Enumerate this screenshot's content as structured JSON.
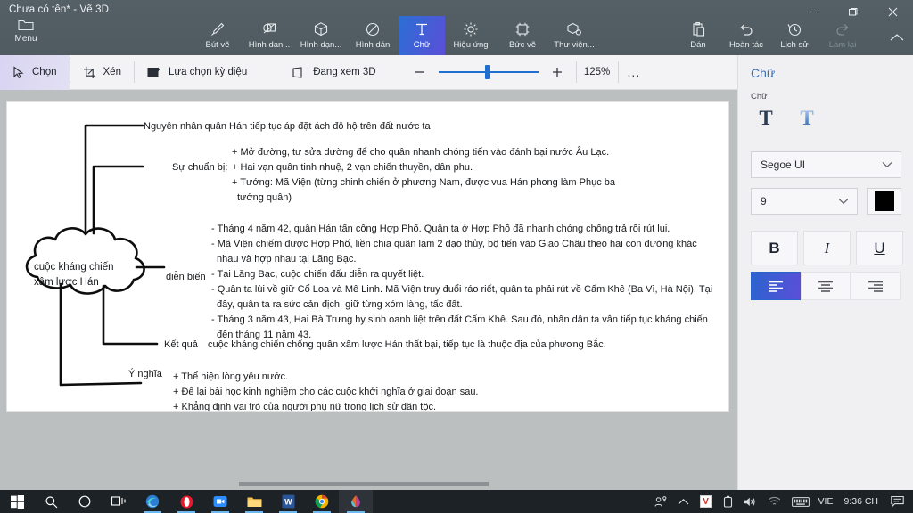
{
  "window": {
    "title": "Chưa có tên* - Vẽ 3D",
    "minimize_label": "Thu nhỏ",
    "maximize_label": "Phóng to",
    "close_label": "Đóng"
  },
  "ribbon": {
    "menu_label": "Menu",
    "tools": [
      {
        "id": "but-ve",
        "label": "Bút vẽ",
        "icon": "brush-icon",
        "active": false
      },
      {
        "id": "hinh-dang-2d",
        "label": "Hình dạn...",
        "icon": "shapes-2d-icon",
        "active": false
      },
      {
        "id": "hinh-dang-3d",
        "label": "Hình dạn...",
        "icon": "shapes-3d-icon",
        "active": false
      },
      {
        "id": "hinh-dan",
        "label": "Hình dán",
        "icon": "sticker-icon",
        "active": false
      },
      {
        "id": "chu",
        "label": "Chữ",
        "icon": "text-icon",
        "active": true
      },
      {
        "id": "hieu-ung",
        "label": "Hiệu ứng",
        "icon": "effects-icon",
        "active": false
      },
      {
        "id": "buc-ve",
        "label": "Bức vẽ",
        "icon": "canvas-icon",
        "active": false
      },
      {
        "id": "thu-vien",
        "label": "Thư viện...",
        "icon": "library-icon",
        "active": false
      }
    ],
    "right_tools": [
      {
        "id": "dan",
        "label": "Dán",
        "icon": "paste-icon",
        "disabled": false
      },
      {
        "id": "hoan-tac",
        "label": "Hoàn tác",
        "icon": "undo-icon",
        "disabled": false
      },
      {
        "id": "lich-su",
        "label": "Lịch sử",
        "icon": "history-icon",
        "disabled": false
      },
      {
        "id": "lam-lai",
        "label": "Làm lại",
        "icon": "redo-icon",
        "disabled": true
      }
    ],
    "collapse_label": "Thu gọn dải băng"
  },
  "subbar": {
    "items": [
      {
        "id": "chon",
        "label": "Chọn",
        "icon": "cursor-select-icon",
        "selected": true
      },
      {
        "id": "xen",
        "label": "Xén",
        "icon": "crop-icon",
        "selected": false
      },
      {
        "id": "lua-chon-ky-dieu",
        "label": "Lựa chọn kỳ diệu",
        "icon": "magic-select-icon",
        "selected": false
      }
    ],
    "view3d_label": "Đang xem 3D",
    "view3d_icon": "view-3d-icon",
    "zoom_out_label": "Thu nhỏ",
    "zoom_in_label": "Phóng to",
    "zoom_value": "125%",
    "zoom_slider_percent": 47,
    "more_label": "..."
  },
  "panel": {
    "title": "Chữ",
    "section_label": "Chữ",
    "text_styles": [
      {
        "id": "text-2d",
        "glyph": "T",
        "label": "Chữ 2D",
        "selected": false
      },
      {
        "id": "text-3d",
        "glyph": "T",
        "label": "Chữ 3D",
        "selected": false
      }
    ],
    "font_family": "Segoe UI",
    "font_size": "9",
    "color_hex": "#000000",
    "bold_label": "B",
    "italic_label": "I",
    "underline_label": "U",
    "align": [
      {
        "id": "align-left",
        "label": "Căn trái",
        "active": true
      },
      {
        "id": "align-center",
        "label": "Căn giữa",
        "active": false
      },
      {
        "id": "align-right",
        "label": "Căn phải",
        "active": false
      }
    ]
  },
  "canvas": {
    "center_node": "cuộc kháng chiến\nxâm lược Hán",
    "center_node_line1": "cuộc kháng chiến",
    "center_node_line2": "xâm lược Hán",
    "branches": [
      {
        "id": "nguyen-nhan",
        "label": "Nguyên nhân",
        "body": "quân Hán tiếp tục áp đặt ách đô hộ trên đất nước ta"
      },
      {
        "id": "su-chuan-bi",
        "label": "Sự chuẩn bị:",
        "lines": [
          "+ Mở đường, tư sửa dường để cho quân nhanh chóng tiến vào đánh bại nước Âu Lạc.",
          "+ Hai vạn quân tinh nhuệ, 2 vạn chiến thuyền, dân phu.",
          "+ Tướng: Mã Viện (từng chinh chiến ở phương Nam, được vua Hán phong làm Phục ba",
          "tướng quân)"
        ]
      },
      {
        "id": "dien-bien",
        "label": "diễn biến",
        "lines": [
          "- Tháng 4 năm 42, quân Hán tấn công Hợp Phố. Quân ta ở Hợp Phố đã nhanh chóng chống trả rồi rút lui.",
          "- Mã Viện chiếm được Hợp Phố, liền chia quân làm 2 đạo thủy, bộ tiến vào Giao Châu theo hai con đường khác",
          "nhau và hợp nhau tại Lăng Bạc.",
          "- Tại Lăng Bạc, cuộc chiến đấu diễn ra quyết liệt.",
          "- Quân ta lùi về giữ Cổ Loa và Mê Linh. Mã Viện truy đuổi ráo riết, quân ta phải rút về Cấm Khê (Ba Vì, Hà Nội). Tại",
          "đây, quân ta ra sức cản địch, giữ từng xóm làng, tấc đất.",
          "- Tháng 3 năm 43, Hai Bà Trưng hy sinh oanh liệt trên đất Cấm Khê. Sau đó, nhân dân ta vẫn tiếp tục kháng chiến",
          "đến tháng 11 năm 43."
        ]
      },
      {
        "id": "ket-qua",
        "label": "Kết quả",
        "body": "cuộc kháng chiến chống quân xâm lược Hán thất bại, tiếp tục là thuộc địa của phương Bắc."
      },
      {
        "id": "y-nghia",
        "label": "Ý nghĩa",
        "lines": [
          "+ Thể hiện lòng yêu nước.",
          "+ Để lại bài học kinh nghiệm cho các cuộc khởi nghĩa ở giai đoạn sau.",
          "+ Khẳng định vai trò của người phụ nữ trong lịch sử dân tộc."
        ]
      }
    ]
  },
  "taskbar": {
    "left_icons": [
      {
        "id": "start",
        "name": "windows-start-icon"
      },
      {
        "id": "search",
        "name": "search-icon"
      },
      {
        "id": "cortana",
        "name": "cortana-circle-icon"
      },
      {
        "id": "task-view",
        "name": "task-view-icon"
      },
      {
        "id": "edge",
        "name": "microsoft-edge-icon"
      },
      {
        "id": "opera",
        "name": "opera-icon"
      },
      {
        "id": "zoom",
        "name": "zoom-app-icon"
      },
      {
        "id": "explorer",
        "name": "file-explorer-icon"
      },
      {
        "id": "word",
        "name": "microsoft-word-icon"
      },
      {
        "id": "chrome",
        "name": "google-chrome-icon"
      },
      {
        "id": "paint3d",
        "name": "paint-3d-icon"
      }
    ],
    "tray": {
      "share_icon": "people-share-icon",
      "chevron_icon": "show-hidden-icons-icon",
      "unikey_badge": "V",
      "battery_icon": "battery-icon",
      "volume_icon": "volume-icon",
      "wifi_icon": "wifi-icon",
      "keyboard_icon": "touch-keyboard-icon",
      "language": "VIE",
      "clock": "9:36 CH",
      "action_center_icon": "action-center-icon"
    }
  }
}
